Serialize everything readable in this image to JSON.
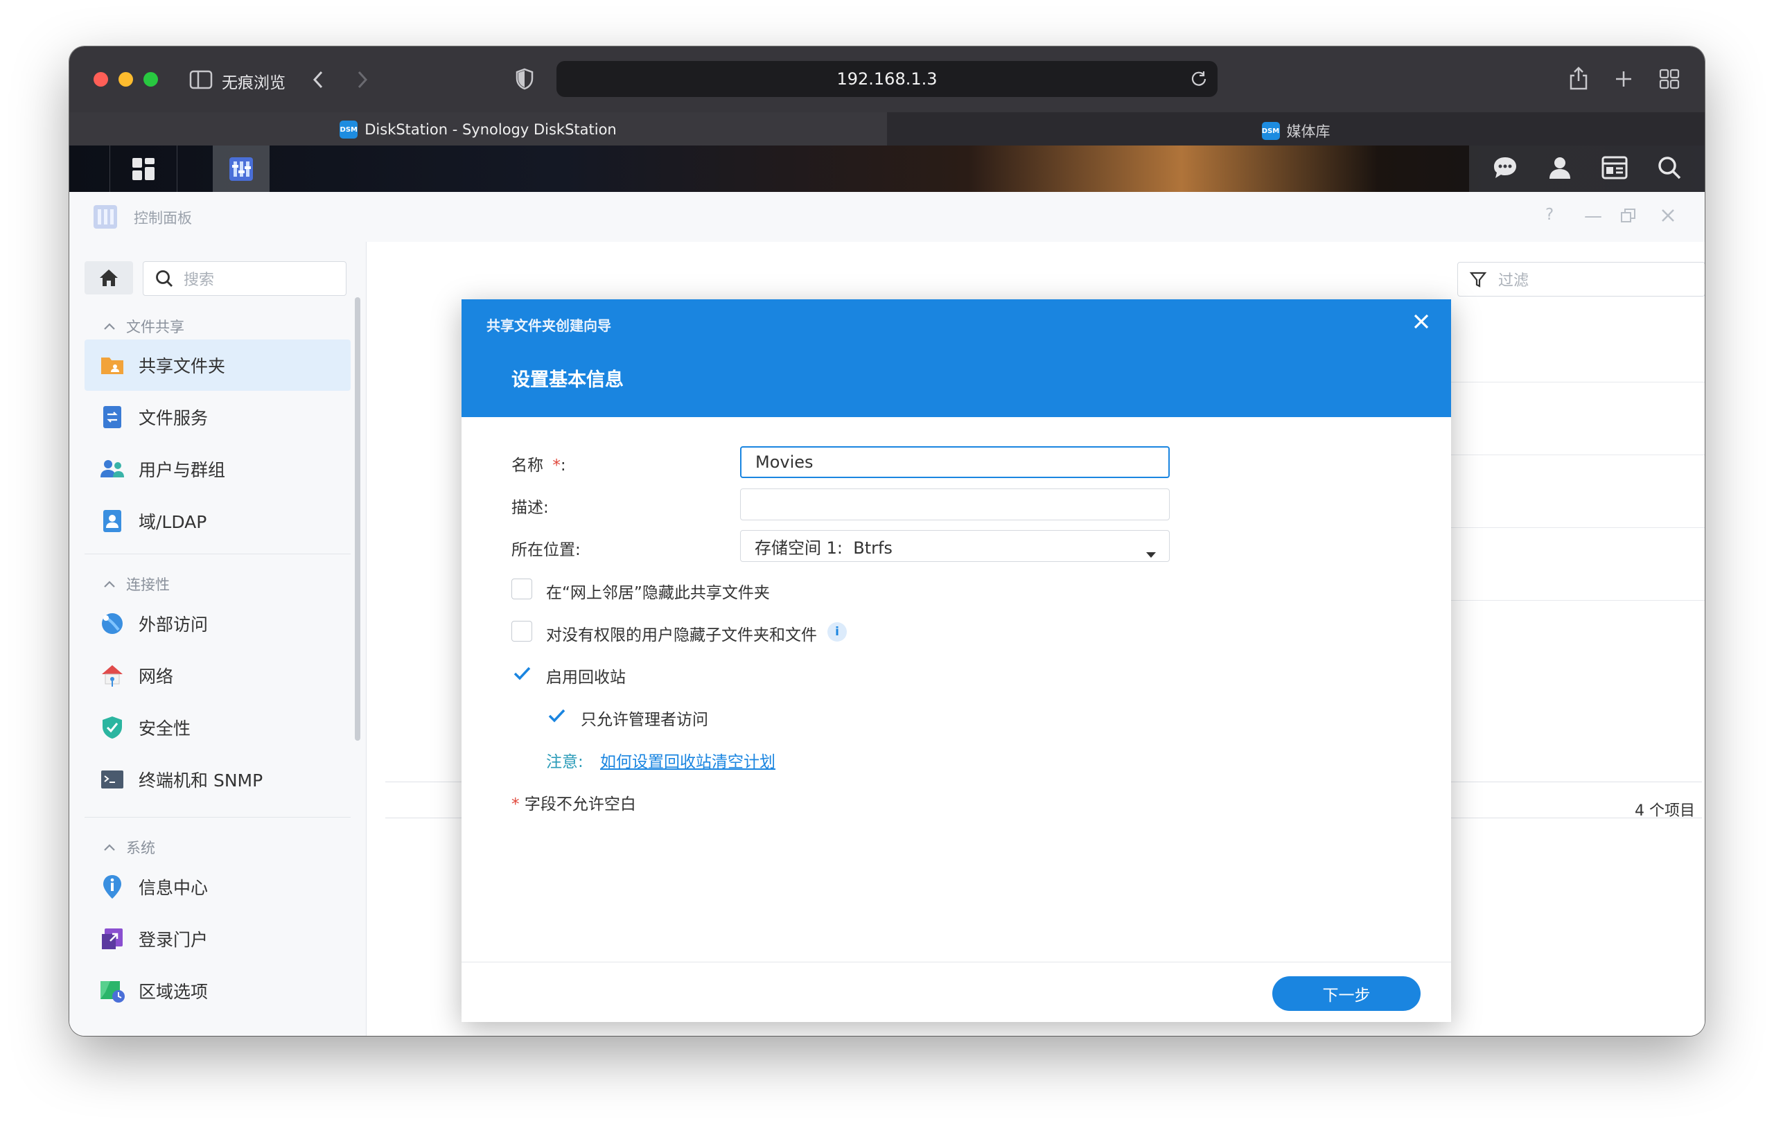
{
  "browser": {
    "private_label": "无痕浏览",
    "address": "192.168.1.3",
    "tabs": [
      {
        "label": "DiskStation - Synology DiskStation",
        "favicon": "DSM"
      },
      {
        "label": "媒体库",
        "favicon": "DSM"
      }
    ]
  },
  "app": {
    "title": "控制面板",
    "search_placeholder": "搜索",
    "filter_placeholder": "过滤",
    "item_count": "4 个项目",
    "sections": [
      {
        "label": "文件共享",
        "items": [
          "共享文件夹",
          "文件服务",
          "用户与群组",
          "域/LDAP"
        ]
      },
      {
        "label": "连接性",
        "items": [
          "外部访问",
          "网络",
          "安全性",
          "终端机和 SNMP"
        ]
      },
      {
        "label": "系统",
        "items": [
          "信息中心",
          "登录门户",
          "区域选项"
        ]
      }
    ]
  },
  "dialog": {
    "wizard_title": "共享文件夹创建向导",
    "step_title": "设置基本信息",
    "name_label": "名称",
    "required_mark": "*",
    "colon": ":",
    "name_value": "Movies",
    "desc_label": "描述:",
    "desc_value": "",
    "location_label": "所在位置:",
    "location_value": "存储空间 1:  Btrfs",
    "checkboxes": [
      {
        "label": "在“网上邻居”隐藏此共享文件夹",
        "checked": false
      },
      {
        "label": "对没有权限的用户隐藏子文件夹和文件",
        "checked": false
      },
      {
        "label": "启用回收站",
        "checked": true
      },
      {
        "label": "只允许管理者访问",
        "checked": true
      }
    ],
    "note_label": "注意:",
    "note_link": "如何设置回收站清空计划",
    "required_note": "字段不允许空白",
    "next_button": "下一步"
  },
  "colors": {
    "accent": "#1a85e0",
    "required": "#e0473b",
    "note": "#2a9bb8"
  }
}
